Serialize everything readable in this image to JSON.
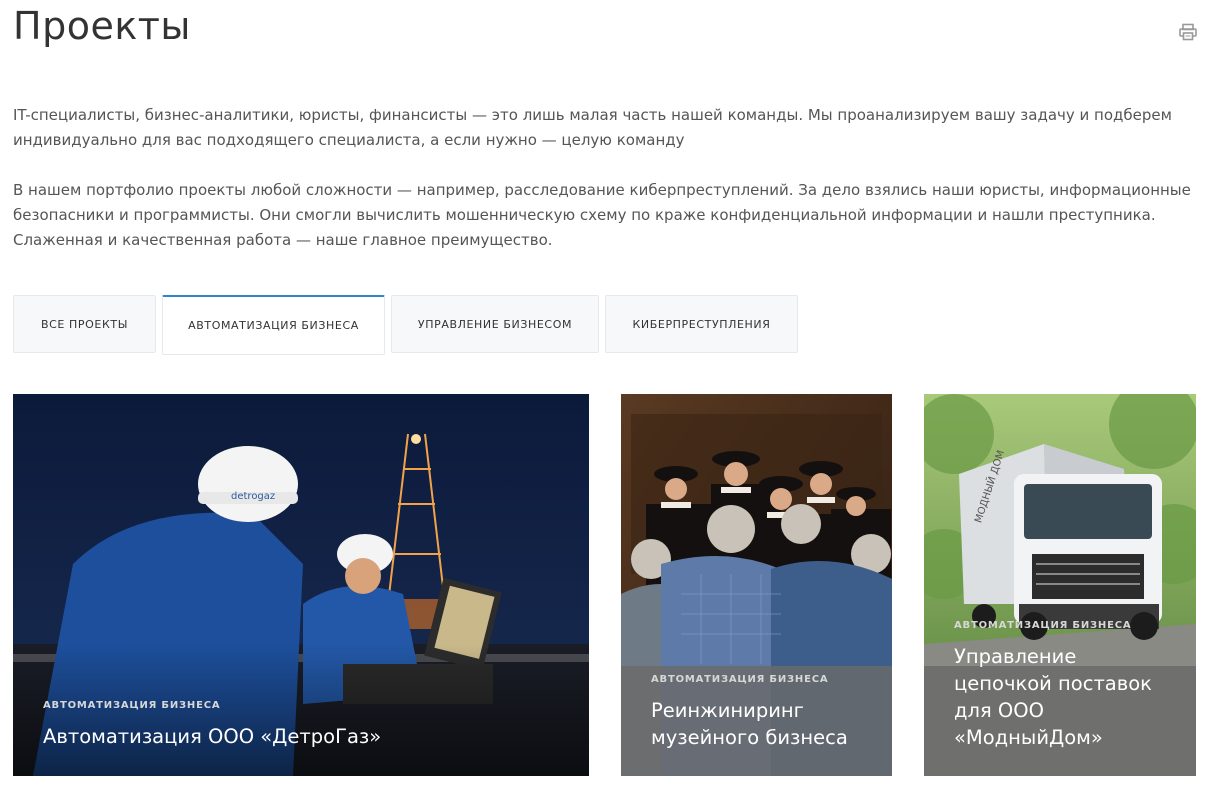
{
  "page": {
    "title": "Проекты",
    "print_icon": "printer-icon"
  },
  "intro": {
    "paragraph1": "IT-специалисты, бизнес-аналитики, юристы, финансисты — это лишь малая часть нашей команды. Мы проанализируем вашу задачу и подберем индивидуально для вас подходящего специалиста, а если нужно — целую команду",
    "paragraph2": "В нашем портфолио проекты любой сложности — например, расследование киберпреступлений. За дело взялись наши юристы, информационные безопасники и программисты. Они смогли вычислить мошенническую схему по краже конфиденциальной информации и нашли преступника. Слаженная и качественная работа — наше главное преимущество."
  },
  "tabs": [
    {
      "label": "Все проекты",
      "active": false
    },
    {
      "label": "Автоматизация бизнеса",
      "active": true
    },
    {
      "label": "Управление бизнесом",
      "active": false
    },
    {
      "label": "Киберпреступления",
      "active": false
    }
  ],
  "cards": [
    {
      "category": "Автоматизация бизнеса",
      "title": "Автоматизация ООО «ДетроГаз»"
    },
    {
      "category": "Автоматизация бизнеса",
      "title": "Реинжиниринг музейного бизнеса"
    },
    {
      "category": "Автоматизация бизнеса",
      "title": "Управление цепочкой поставок для ООО «МодныйДом»"
    }
  ],
  "photo_text": {
    "helmet_logo": "detrogaz",
    "truck_logo": "МОДНЫЙ ДОМ"
  },
  "colors": {
    "accent": "#2f86c6",
    "tab_bg": "#f7f8fa",
    "text": "#555555"
  }
}
